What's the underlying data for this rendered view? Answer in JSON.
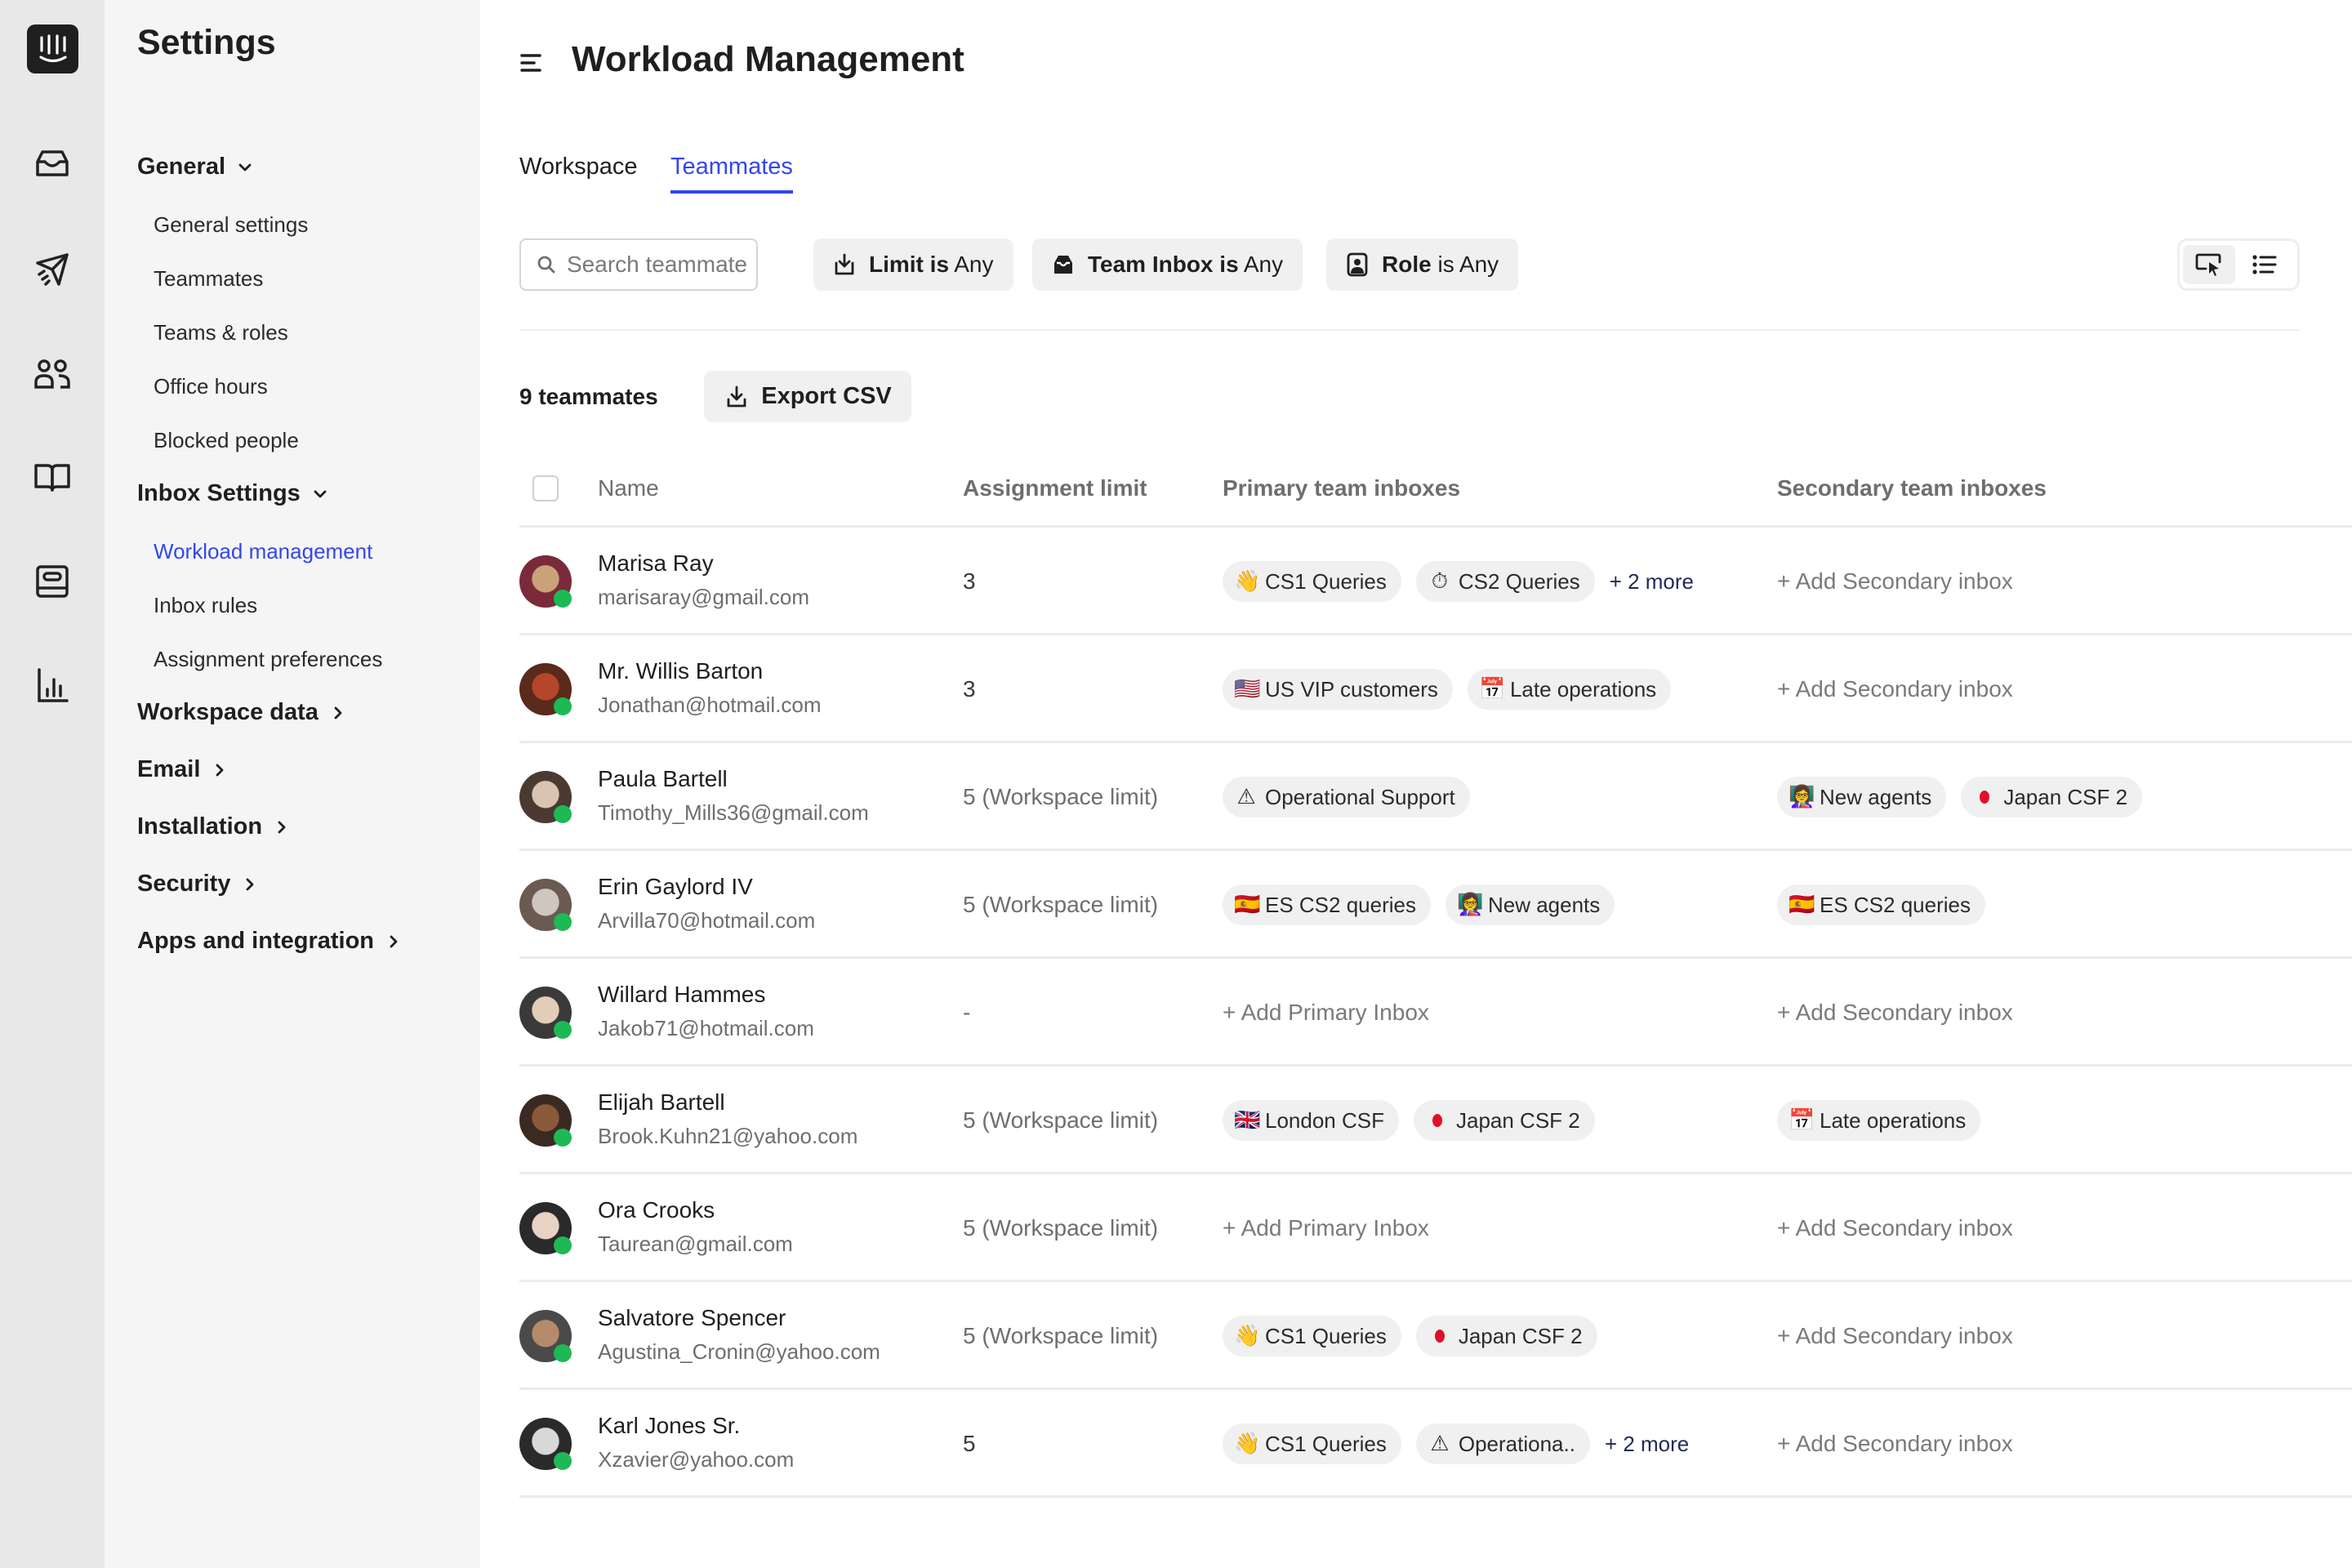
{
  "rail": {
    "logo": "intercom-logo",
    "icons": [
      "inbox-icon",
      "paper-plane-icon",
      "people-icon",
      "book-icon",
      "tray-icon",
      "bar-chart-icon"
    ]
  },
  "sidebar": {
    "title": "Settings",
    "groups": [
      {
        "label": "General",
        "expanded": true,
        "items": [
          "General settings",
          "Teammates",
          "Teams & roles",
          "Office hours",
          "Blocked people"
        ]
      },
      {
        "label": "Inbox Settings",
        "expanded": true,
        "items": [
          "Workload management",
          "Inbox rules",
          "Assignment preferences"
        ]
      },
      {
        "label": "Workspace data",
        "expanded": false
      },
      {
        "label": "Email",
        "expanded": false
      },
      {
        "label": "Installation",
        "expanded": false
      },
      {
        "label": "Security",
        "expanded": false
      },
      {
        "label": "Apps and integration",
        "expanded": false
      }
    ],
    "active_item": "Workload management"
  },
  "header": {
    "title": "Workload Management"
  },
  "tabs": [
    {
      "label": "Workspace",
      "active": false
    },
    {
      "label": "Teammates",
      "active": true
    }
  ],
  "filters": {
    "search_placeholder": "Search teammates",
    "search_value": "",
    "limit": {
      "label": "Limit is",
      "value": "Any"
    },
    "team_inbox": {
      "label": "Team Inbox is",
      "value": "Any"
    },
    "role": {
      "label": "Role",
      "value": "is Any"
    }
  },
  "view_toggle": {
    "options": [
      "card-view",
      "list-view"
    ],
    "active": "card-view"
  },
  "summary": {
    "count_label": "9 teammates",
    "export_label": "Export CSV"
  },
  "table": {
    "columns": [
      "Name",
      "Assignment limit",
      "Primary team inboxes",
      "Secondary team inboxes"
    ],
    "add_primary_label": "+ Add Primary Inbox",
    "add_secondary_label": "+ Add Secondary inbox",
    "rows": [
      {
        "name": "Marisa Ray",
        "email": "marisaray@gmail.com",
        "limit": "3",
        "status": "online",
        "primary": [
          {
            "emoji": "👋",
            "label": "CS1 Queries"
          },
          {
            "emoji": "⏱",
            "label": "CS2 Queries"
          }
        ],
        "primary_more": "+ 2 more",
        "secondary": []
      },
      {
        "name": "Mr. Willis Barton",
        "email": "Jonathan@hotmail.com",
        "limit": "3",
        "status": "online",
        "primary": [
          {
            "emoji": "🇺🇸",
            "label": "US VIP customers"
          },
          {
            "emoji": "📅",
            "label": "Late operations"
          }
        ],
        "secondary": []
      },
      {
        "name": "Paula Bartell",
        "email": "Timothy_Mills36@gmail.com",
        "limit": "5 (Workspace limit)",
        "status": "online",
        "primary": [
          {
            "emoji": "⚠",
            "label": "Operational Support"
          }
        ],
        "secondary": [
          {
            "emoji": "👩‍🏫",
            "label": "New agents"
          },
          {
            "emoji": "jp",
            "label": "Japan CSF 2"
          }
        ]
      },
      {
        "name": "Erin Gaylord IV",
        "email": "Arvilla70@hotmail.com",
        "limit": "5 (Workspace limit)",
        "status": "online",
        "primary": [
          {
            "emoji": "🇪🇸",
            "label": "ES CS2 queries"
          },
          {
            "emoji": "👩‍🏫",
            "label": "New agents"
          }
        ],
        "secondary": [
          {
            "emoji": "🇪🇸",
            "label": "ES CS2 queries"
          }
        ]
      },
      {
        "name": "Willard Hammes",
        "email": "Jakob71@hotmail.com",
        "limit": "-",
        "status": "online",
        "primary": [],
        "secondary": []
      },
      {
        "name": "Elijah Bartell",
        "email": "Brook.Kuhn21@yahoo.com",
        "limit": "5 (Workspace limit)",
        "status": "online",
        "primary": [
          {
            "emoji": "🇬🇧",
            "label": "London CSF"
          },
          {
            "emoji": "jp",
            "label": "Japan CSF 2"
          }
        ],
        "secondary": [
          {
            "emoji": "📅",
            "label": "Late operations"
          }
        ]
      },
      {
        "name": "Ora Crooks",
        "email": "Taurean@gmail.com",
        "limit": "5 (Workspace limit)",
        "status": "online",
        "primary": [],
        "secondary": []
      },
      {
        "name": "Salvatore Spencer",
        "email": "Agustina_Cronin@yahoo.com",
        "limit": "5 (Workspace limit)",
        "status": "online",
        "primary": [
          {
            "emoji": "👋",
            "label": "CS1 Queries"
          },
          {
            "emoji": "jp",
            "label": "Japan CSF 2"
          }
        ],
        "secondary": []
      },
      {
        "name": "Karl Jones Sr.",
        "email": "Xzavier@yahoo.com",
        "limit": "5",
        "status": "online",
        "primary": [
          {
            "emoji": "👋",
            "label": "CS1 Queries"
          },
          {
            "emoji": "⚠",
            "label": "Operationa.."
          }
        ],
        "primary_more": "+ 2 more",
        "secondary": []
      }
    ]
  },
  "colors": {
    "accent": "#3346f0",
    "rail_bg": "#e8e8e8",
    "sidebar_bg": "#f5f5f5",
    "chip_bg": "#f0f0f0",
    "online": "#1db954",
    "more_link": "#1f2a55"
  }
}
